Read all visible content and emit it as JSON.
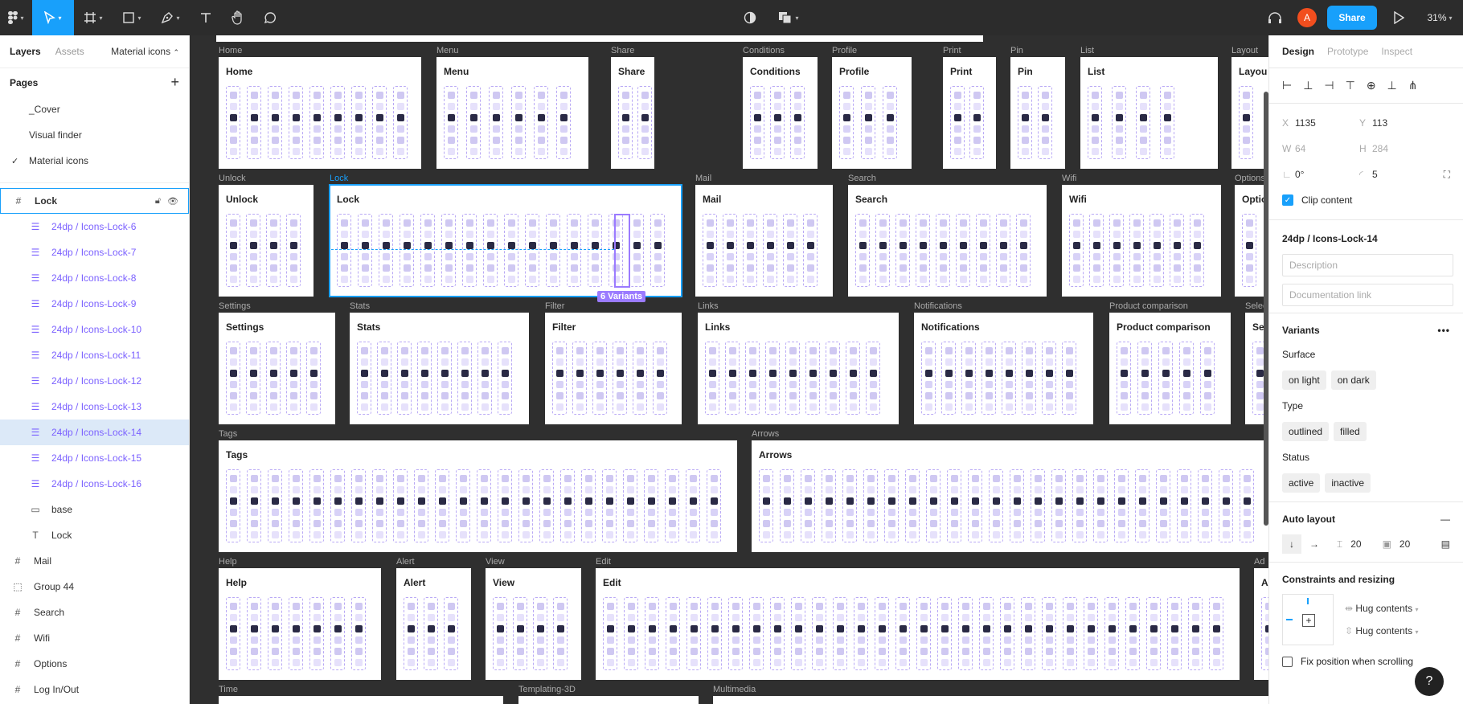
{
  "toolbar": {
    "share_label": "Share",
    "avatar_initial": "A",
    "zoom": "31%",
    "accent": "#18a0fb",
    "avatar_color": "#f24e1e"
  },
  "left_panel": {
    "tabs": [
      "Layers",
      "Assets"
    ],
    "page_selector": "Material icons",
    "pages_title": "Pages",
    "pages": [
      "_Cover",
      "Visual finder",
      "Material icons"
    ],
    "selected_frame": "Lock",
    "children": [
      "24dp / Icons-Lock-6",
      "24dp / Icons-Lock-7",
      "24dp / Icons-Lock-8",
      "24dp / Icons-Lock-9",
      "24dp / Icons-Lock-10",
      "24dp / Icons-Lock-11",
      "24dp / Icons-Lock-12",
      "24dp / Icons-Lock-13",
      "24dp / Icons-Lock-14",
      "24dp / Icons-Lock-15",
      "24dp / Icons-Lock-16"
    ],
    "plain_children": [
      "base",
      "Lock"
    ],
    "top_frames": [
      "Mail",
      "Group 44",
      "Search",
      "Wifi",
      "Options",
      "Log In/Out"
    ]
  },
  "canvas": {
    "variants_badge": "6 Variants",
    "frames": [
      {
        "label": "Home",
        "title": "Home"
      },
      {
        "label": "Menu",
        "title": "Menu"
      },
      {
        "label": "Share",
        "title": "Share"
      },
      {
        "label": "Conditions",
        "title": "Conditions"
      },
      {
        "label": "Profile",
        "title": "Profile"
      },
      {
        "label": "Print",
        "title": "Print"
      },
      {
        "label": "Pin",
        "title": "Pin"
      },
      {
        "label": "List",
        "title": "List"
      },
      {
        "label": "Layout",
        "title": "Layou"
      },
      {
        "label": "Unlock",
        "title": "Unlock"
      },
      {
        "label": "Lock",
        "title": "Lock"
      },
      {
        "label": "Mail",
        "title": "Mail"
      },
      {
        "label": "Search",
        "title": "Search"
      },
      {
        "label": "Wifi",
        "title": "Wifi"
      },
      {
        "label": "Options",
        "title": "Optio"
      },
      {
        "label": "Settings",
        "title": "Settings"
      },
      {
        "label": "Stats",
        "title": "Stats"
      },
      {
        "label": "Filter",
        "title": "Filter"
      },
      {
        "label": "Links",
        "title": "Links"
      },
      {
        "label": "Notifications",
        "title": "Notifications"
      },
      {
        "label": "Product comparison",
        "title": "Product comparison"
      },
      {
        "label": "Selec",
        "title": "Sele"
      },
      {
        "label": "Tags",
        "title": "Tags"
      },
      {
        "label": "Arrows",
        "title": "Arrows"
      },
      {
        "label": "Help",
        "title": "Help"
      },
      {
        "label": "Alert",
        "title": "Alert"
      },
      {
        "label": "View",
        "title": "View"
      },
      {
        "label": "Edit",
        "title": "Edit"
      },
      {
        "label": "Ad",
        "title": "A"
      },
      {
        "label": "Time",
        "title": ""
      },
      {
        "label": "Templating-3D",
        "title": ""
      },
      {
        "label": "Multimedia",
        "title": ""
      }
    ]
  },
  "right_panel": {
    "tabs": [
      "Design",
      "Prototype",
      "Inspect"
    ],
    "x_label": "X",
    "x": "1135",
    "y_label": "Y",
    "y": "113",
    "w_label": "W",
    "w": "64",
    "h_label": "H",
    "h": "284",
    "rotation": "0°",
    "radius": "5",
    "clip_content": "Clip content",
    "component_name": "24dp / Icons-Lock-14",
    "description_placeholder": "Description",
    "doc_link_placeholder": "Documentation link",
    "variants_title": "Variants",
    "variant_groups": [
      {
        "name": "Surface",
        "options": [
          "on light",
          "on dark"
        ]
      },
      {
        "name": "Type",
        "options": [
          "outlined",
          "filled"
        ]
      },
      {
        "name": "Status",
        "options": [
          "active",
          "inactive"
        ]
      }
    ],
    "auto_layout_title": "Auto layout",
    "spacing": "20",
    "padding": "20",
    "constraints_title": "Constraints and resizing",
    "hug_h": "Hug contents",
    "hug_v": "Hug contents",
    "fix_position": "Fix position when scrolling",
    "help": "?"
  }
}
